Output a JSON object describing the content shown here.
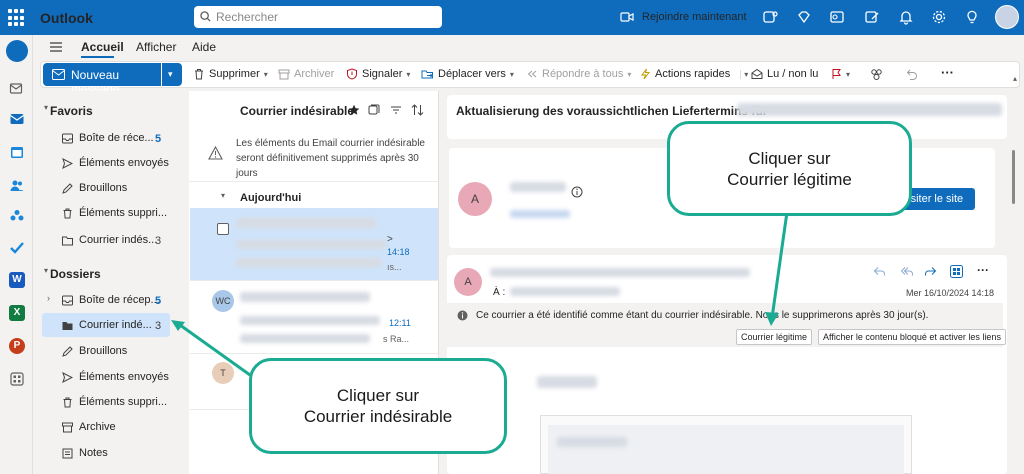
{
  "app": {
    "name": "Outlook"
  },
  "search": {
    "placeholder": "Rechercher"
  },
  "header": {
    "join_now": "Rejoindre maintenant"
  },
  "menu": {
    "tabs": [
      "Accueil",
      "Afficher",
      "Aide"
    ],
    "active": "Accueil"
  },
  "toolbar": {
    "new_message": "Nouveau message",
    "delete": "Supprimer",
    "archive": "Archiver",
    "report": "Signaler",
    "move_to": "Déplacer vers",
    "reply_all": "Répondre à tous",
    "quick_actions": "Actions rapides",
    "read_unread": "Lu / non lu",
    "more": "···"
  },
  "folders": {
    "favorites_title": "Favoris",
    "favorites": [
      {
        "label": "Boîte de réce...",
        "count": "5"
      },
      {
        "label": "Éléments envoyés",
        "count": ""
      },
      {
        "label": "Brouillons",
        "count": ""
      },
      {
        "label": "Éléments suppri...",
        "count": ""
      },
      {
        "label": "Courrier indés...",
        "count": "3"
      }
    ],
    "folders_title": "Dossiers",
    "folders": [
      {
        "label": "Boîte de récep...",
        "count": "5"
      },
      {
        "label": "Courrier indé...",
        "count": "3"
      },
      {
        "label": "Brouillons",
        "count": ""
      },
      {
        "label": "Éléments envoyés",
        "count": ""
      },
      {
        "label": "Éléments suppri...",
        "count": ""
      },
      {
        "label": "Archive",
        "count": ""
      },
      {
        "label": "Notes",
        "count": ""
      }
    ]
  },
  "list": {
    "title": "Courrier indésirable",
    "notice": "Les éléments du Email courrier indésirable seront définitivement supprimés après 30 jours",
    "group": "Aujourd'hui",
    "messages": [
      {
        "avatar": "",
        "time": "14:18",
        "snippet_tail": "ıs...",
        "marker": ">"
      },
      {
        "avatar": "WC",
        "time": "12:11",
        "snippet_tail": "s Ra..."
      },
      {
        "avatar": "T",
        "time": "",
        "snippet_tail": ""
      }
    ]
  },
  "reading": {
    "subject": "Aktualisierung des voraussichtlichen Liefertermins für",
    "sender_avatar": "A",
    "visit_site": "Visiter le site",
    "to_label": "À :",
    "date": "Mer 16/10/2024 14:18",
    "junk_notice": "Ce courrier a été identifié comme étant du courrier indésirable. Nous le supprimerons après 30 jour(s).",
    "not_junk_button": "Courrier légitime",
    "show_blocked_button": "Afficher le contenu bloqué et activer les liens"
  },
  "annotations": {
    "callout_legit": "Cliquer sur\nCourrier légitime",
    "callout_junk": "Cliquer sur\nCourrier indésirable"
  },
  "colors": {
    "brand": "#0f6cbd",
    "callout_border": "#1aab92",
    "selected": "#cfe4fa"
  }
}
